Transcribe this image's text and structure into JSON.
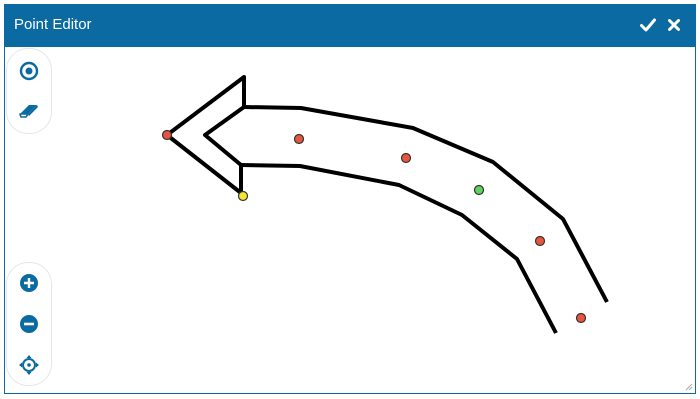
{
  "window": {
    "title": "Point Editor",
    "accent_color": "#0a6aa1"
  },
  "titlebar_actions": [
    {
      "name": "confirm",
      "icon": "checkmark-icon"
    },
    {
      "name": "close",
      "icon": "close-icon"
    }
  ],
  "toolbar_top": [
    {
      "name": "select-point-tool",
      "icon": "target-circle-icon"
    },
    {
      "name": "eraser-tool",
      "icon": "eraser-icon"
    }
  ],
  "toolbar_bottom": [
    {
      "name": "zoom-in-button",
      "icon": "plus-circle-icon"
    },
    {
      "name": "zoom-out-button",
      "icon": "minus-circle-icon"
    },
    {
      "name": "recenter-button",
      "icon": "crosshair-move-icon"
    }
  ],
  "point_colors": {
    "default": "#e8553e",
    "start": "#f5e52e",
    "selected": "#5fd35f"
  }
}
